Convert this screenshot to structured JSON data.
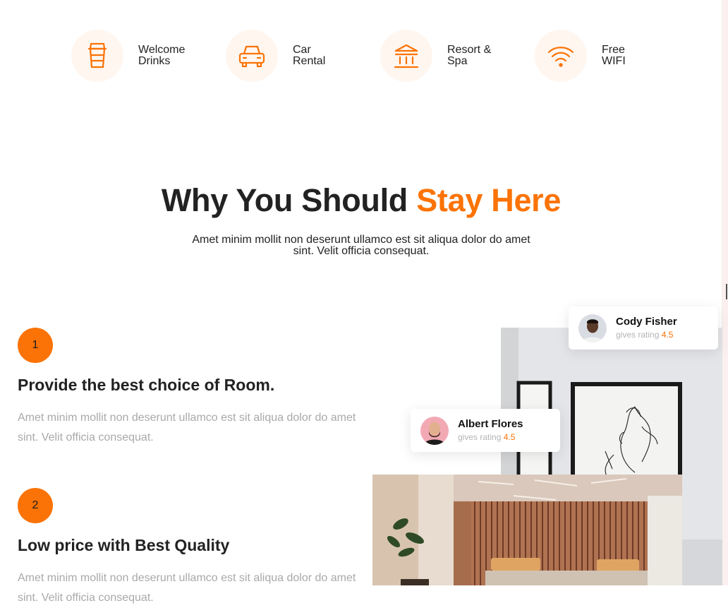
{
  "amenities": [
    {
      "icon": "cup-icon",
      "label": "Welcome\nDrinks"
    },
    {
      "icon": "car-icon",
      "label": "Car\nRental"
    },
    {
      "icon": "bank-icon",
      "label": "Resort &\nSpa"
    },
    {
      "icon": "wifi-icon",
      "label": "Free\nWIFI"
    }
  ],
  "section": {
    "title_main": "Why You Should ",
    "title_accent": "Stay Here",
    "subtitle": "Amet minim mollit non deserunt ullamco est sit aliqua dolor do amet sint. Velit officia consequat."
  },
  "features": [
    {
      "number": "1",
      "title": "Provide the best choice of Room.",
      "text": "Amet minim mollit non deserunt ullamco est sit aliqua dolor do amet sint. Velit officia consequat."
    },
    {
      "number": "2",
      "title": "Low price with Best Quality",
      "text": "Amet minim mollit non deserunt ullamco est sit aliqua dolor do amet sint. Velit officia consequat."
    }
  ],
  "reviews": [
    {
      "name": "Cody Fisher",
      "prefix": "gives rating",
      "rating": "4.5"
    },
    {
      "name": "Albert Flores",
      "prefix": "gives rating",
      "rating": "4.5"
    }
  ],
  "colors": {
    "accent": "#fb7306",
    "icon_bg": "#fff6f0",
    "muted_text": "#a9a9a9"
  }
}
